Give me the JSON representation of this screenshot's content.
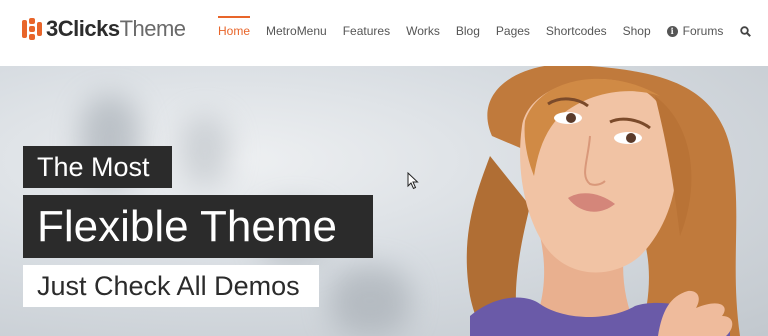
{
  "logo": {
    "bold": "3Clicks",
    "light": "Theme"
  },
  "nav": {
    "items": [
      {
        "label": "Home",
        "active": true
      },
      {
        "label": "MetroMenu"
      },
      {
        "label": "Features"
      },
      {
        "label": "Works"
      },
      {
        "label": "Blog"
      },
      {
        "label": "Pages"
      },
      {
        "label": "Shortcodes"
      },
      {
        "label": "Shop"
      },
      {
        "label": "Forums",
        "icon": "info-icon"
      }
    ],
    "search_icon": "search-icon",
    "cart_icon": "cart-icon"
  },
  "hero": {
    "line1": "The Most",
    "line2": "Flexible Theme",
    "line3": "Just Check All Demos"
  },
  "colors": {
    "accent": "#e8652a",
    "dark_box": "#2b2b2b",
    "text": "#555555"
  }
}
